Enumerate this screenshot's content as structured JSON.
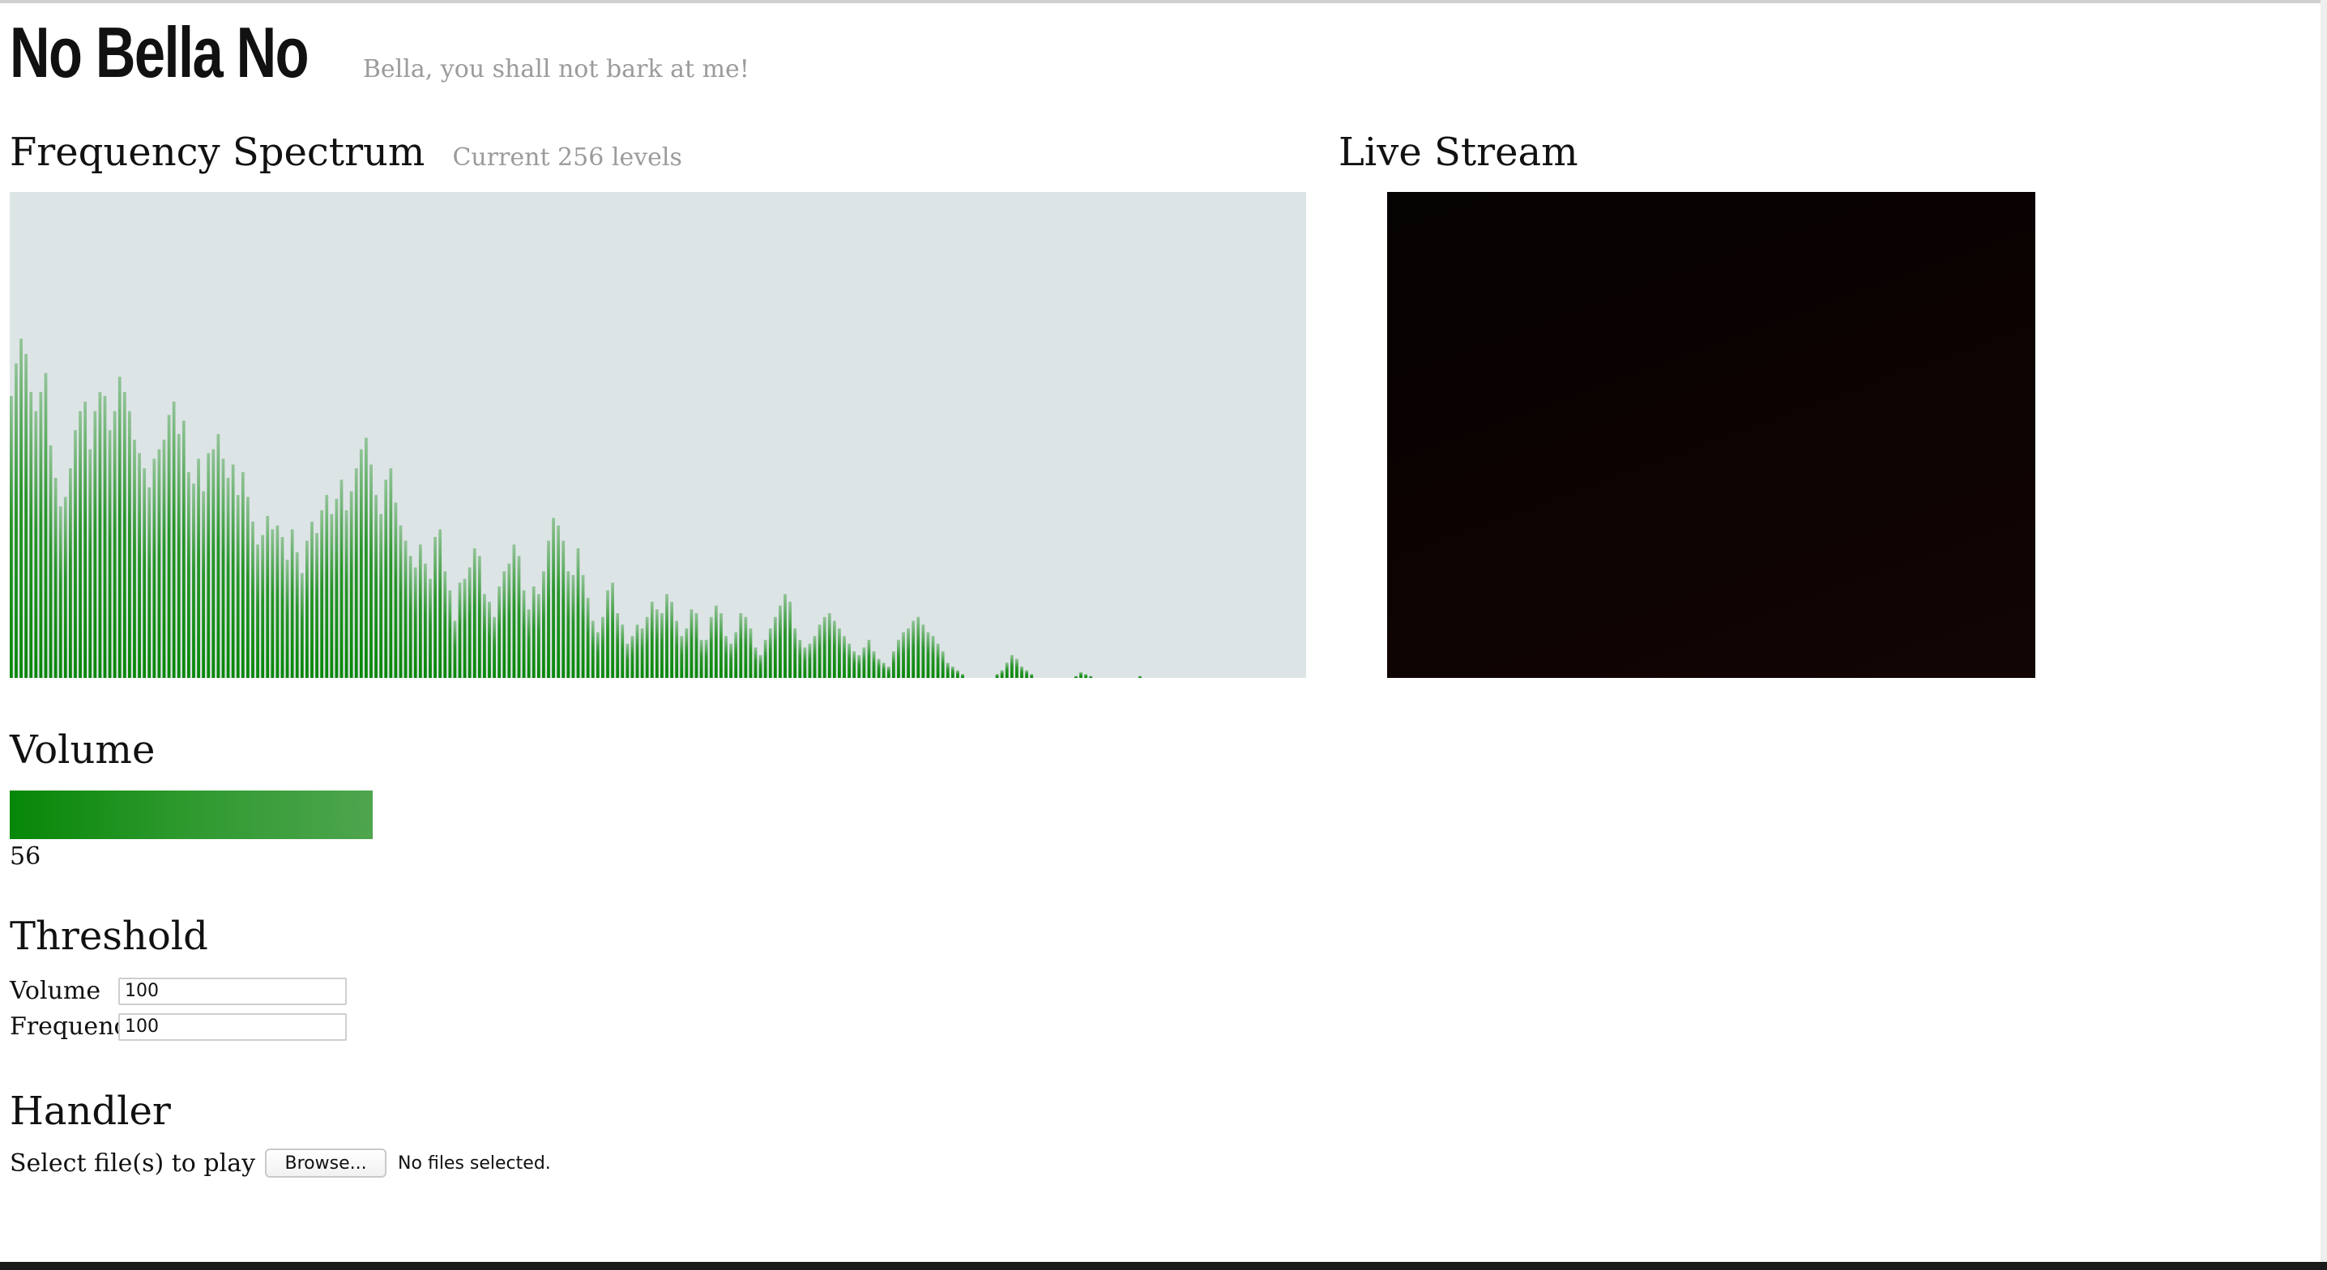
{
  "header": {
    "title": "No Bella No",
    "subtitle": "Bella, you shall not bark at me!"
  },
  "spectrum": {
    "title": "Frequency Spectrum",
    "subtitle": "Current 256 levels"
  },
  "live_stream": {
    "title": "Live Stream"
  },
  "volume": {
    "title": "Volume",
    "value": "56",
    "fill_fraction": 0.56
  },
  "threshold": {
    "title": "Threshold",
    "volume_label": "Volume",
    "volume_value": "100",
    "frequency_label": "Frequency",
    "frequency_value": "100"
  },
  "handler": {
    "title": "Handler",
    "select_label": "Select file(s) to play",
    "browse_label": "Browse...",
    "file_status": "No files selected."
  },
  "colors": {
    "spectrum_background": "#dde4e6",
    "bar_color": "#078707",
    "stream_background": "#0b0202"
  },
  "chart_data": {
    "type": "bar",
    "levels": 256,
    "ylim": [
      0,
      255
    ],
    "values": [
      148,
      165,
      178,
      170,
      150,
      140,
      150,
      160,
      122,
      105,
      90,
      95,
      110,
      130,
      140,
      145,
      120,
      140,
      150,
      148,
      130,
      140,
      158,
      150,
      140,
      125,
      118,
      110,
      100,
      115,
      120,
      125,
      138,
      145,
      128,
      135,
      108,
      102,
      115,
      98,
      118,
      120,
      128,
      115,
      105,
      112,
      96,
      108,
      95,
      82,
      70,
      75,
      85,
      78,
      80,
      74,
      62,
      78,
      66,
      55,
      72,
      82,
      76,
      88,
      96,
      86,
      94,
      104,
      88,
      98,
      110,
      120,
      126,
      112,
      96,
      86,
      104,
      110,
      92,
      80,
      72,
      64,
      58,
      70,
      60,
      52,
      74,
      78,
      56,
      46,
      30,
      50,
      52,
      58,
      68,
      64,
      44,
      40,
      32,
      48,
      56,
      60,
      70,
      64,
      46,
      36,
      48,
      44,
      56,
      72,
      84,
      80,
      72,
      56,
      54,
      68,
      54,
      42,
      30,
      24,
      32,
      46,
      50,
      34,
      28,
      18,
      22,
      28,
      26,
      32,
      40,
      36,
      34,
      44,
      40,
      30,
      22,
      26,
      36,
      34,
      20,
      20,
      32,
      38,
      34,
      22,
      18,
      24,
      34,
      32,
      26,
      16,
      12,
      20,
      26,
      32,
      38,
      44,
      40,
      26,
      20,
      16,
      18,
      22,
      28,
      32,
      34,
      30,
      26,
      22,
      18,
      14,
      12,
      16,
      20,
      14,
      10,
      8,
      6,
      14,
      20,
      24,
      26,
      30,
      32,
      28,
      24,
      22,
      18,
      14,
      8,
      6,
      4,
      2,
      0,
      0,
      0,
      0,
      0,
      0,
      2,
      4,
      8,
      12,
      10,
      6,
      4,
      2,
      0,
      0,
      0,
      0,
      0,
      0,
      0,
      0,
      1,
      3,
      2,
      1,
      0,
      0,
      0,
      0,
      0,
      0,
      0,
      0,
      0,
      1,
      0,
      0,
      0,
      0,
      0,
      0,
      0,
      0,
      0,
      0,
      0,
      0,
      0,
      0,
      0,
      0,
      0,
      0,
      0,
      0,
      0,
      0,
      0,
      0,
      0,
      0,
      0,
      0,
      0,
      0,
      0,
      0,
      0
    ]
  }
}
